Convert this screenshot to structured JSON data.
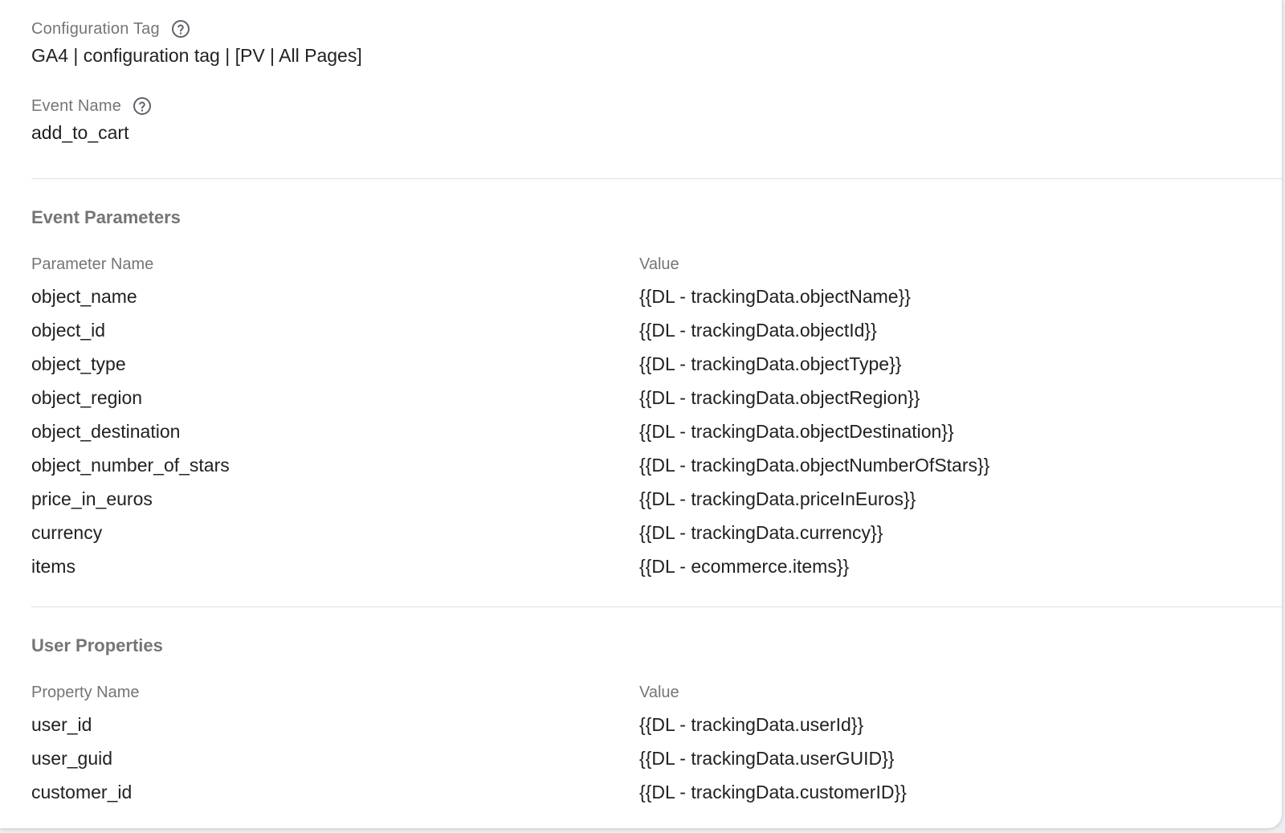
{
  "configuration_tag": {
    "label": "Configuration Tag",
    "value": "GA4 | configuration tag | [PV | All Pages]",
    "help_icon": "help-circle-icon"
  },
  "event_name": {
    "label": "Event Name",
    "value": "add_to_cart",
    "help_icon": "help-circle-icon"
  },
  "event_parameters": {
    "title": "Event Parameters",
    "name_header": "Parameter Name",
    "value_header": "Value",
    "rows": [
      {
        "name": "object_name",
        "value": "{{DL - trackingData.objectName}}"
      },
      {
        "name": "object_id",
        "value": "{{DL - trackingData.objectId}}"
      },
      {
        "name": "object_type",
        "value": "{{DL - trackingData.objectType}}"
      },
      {
        "name": "object_region",
        "value": "{{DL - trackingData.objectRegion}}"
      },
      {
        "name": "object_destination",
        "value": "{{DL - trackingData.objectDestination}}"
      },
      {
        "name": "object_number_of_stars",
        "value": "{{DL - trackingData.objectNumberOfStars}}"
      },
      {
        "name": "price_in_euros",
        "value": "{{DL - trackingData.priceInEuros}}"
      },
      {
        "name": "currency",
        "value": "{{DL - trackingData.currency}}"
      },
      {
        "name": "items",
        "value": "{{DL - ecommerce.items}}"
      }
    ]
  },
  "user_properties": {
    "title": "User Properties",
    "name_header": "Property Name",
    "value_header": "Value",
    "rows": [
      {
        "name": "user_id",
        "value": "{{DL - trackingData.userId}}"
      },
      {
        "name": "user_guid",
        "value": "{{DL - trackingData.userGUID}}"
      },
      {
        "name": "customer_id",
        "value": "{{DL - trackingData.customerID}}"
      }
    ]
  }
}
